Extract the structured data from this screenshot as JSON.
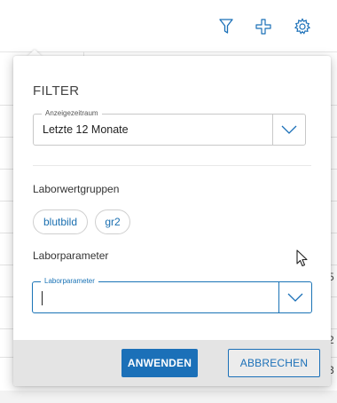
{
  "toolbar": {
    "icons": [
      "filter-icon",
      "plus-icon",
      "gear-icon"
    ],
    "accent": "#1b70b8"
  },
  "background": {
    "edge_chars": [
      "5",
      "2",
      "3"
    ]
  },
  "filter": {
    "title": "FILTER",
    "time_range": {
      "legend": "Anzeigezeitraum",
      "value": "Letzte 12 Monate"
    },
    "lab_groups": {
      "label": "Laborwertgruppen",
      "chips": [
        "blutbild",
        "gr2"
      ]
    },
    "lab_params": {
      "label": "Laborparameter",
      "legend": "Laborparameter",
      "value": ""
    },
    "apply_label": "ANWENDEN",
    "cancel_label": "ABBRECHEN"
  }
}
